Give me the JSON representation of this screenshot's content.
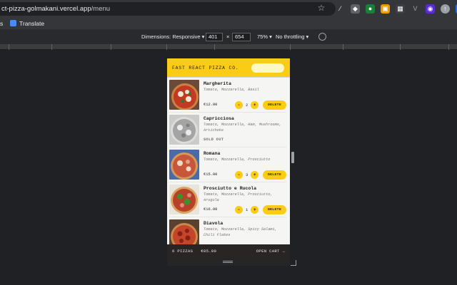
{
  "browser": {
    "url_host": "ct-pizza-golmakani.vercel.app",
    "url_path": "/menu",
    "bookmarks": [
      "s",
      "Translate"
    ]
  },
  "devtools": {
    "dimensions_label": "Dimensions: Responsive ▾",
    "width": "401",
    "times": "×",
    "height": "654",
    "zoom": "75% ▾",
    "throttling": "No throttling ▾"
  },
  "app": {
    "logo": "FAST REACT PIZZA CO.",
    "search_placeholder": "",
    "accent": "#facc15",
    "menu": [
      {
        "name": "Margherita",
        "ingredients": "Tomato, Mozzarella, Basil",
        "price": "€12.00",
        "qty": "2",
        "sold_out": false,
        "delete_label": "DELETE"
      },
      {
        "name": "Capricciosa",
        "ingredients": "Tomato, Mozzarella, Ham, Mushrooms, Artichoke",
        "price": "",
        "status": "SOLD OUT",
        "sold_out": true
      },
      {
        "name": "Romana",
        "ingredients": "Tomato, Mozzarella, Prosciutto",
        "price": "€15.00",
        "qty": "3",
        "sold_out": false,
        "delete_label": "DELETE"
      },
      {
        "name": "Prosciutto e Rucola",
        "ingredients": "Tomato, Mozzarella, Prosciutto, Arugula",
        "price": "€16.00",
        "qty": "1",
        "sold_out": false,
        "delete_label": "DELETE"
      },
      {
        "name": "Diavola",
        "ingredients": "Tomato, Mozzarella, Spicy Salami, Chili Flakes",
        "price": "",
        "sold_out": false
      }
    ],
    "cart": {
      "count": "6 PIZZAS",
      "total": "€85.00",
      "link": "OPEN CART →"
    },
    "stepper": {
      "minus": "-",
      "plus": "+"
    }
  }
}
